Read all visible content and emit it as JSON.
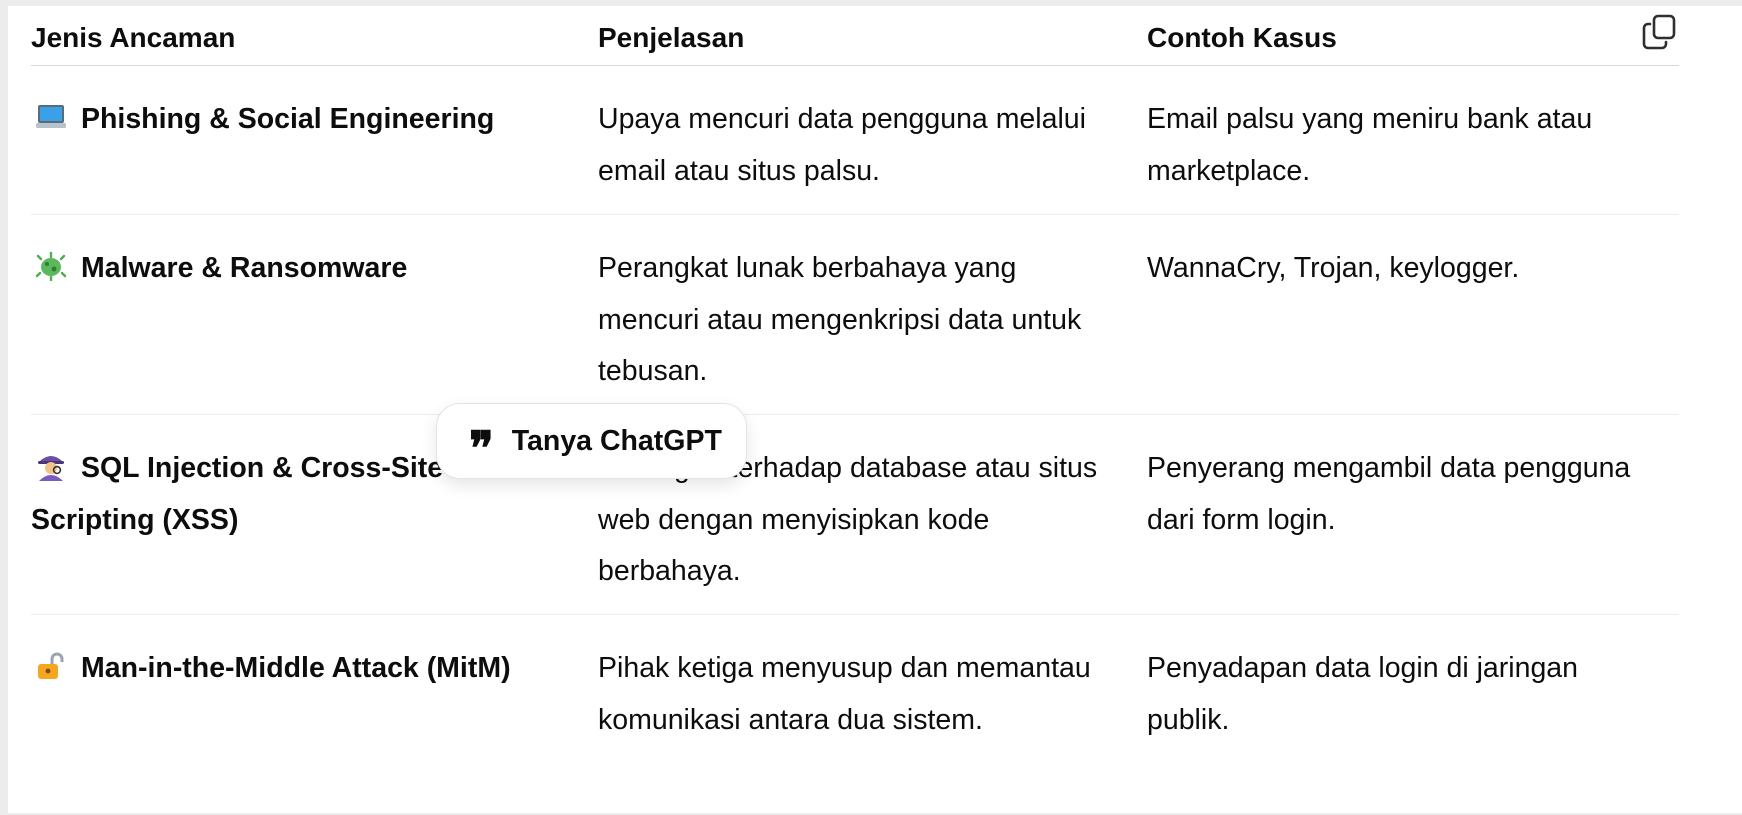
{
  "table": {
    "headers": [
      "Jenis Ancaman",
      "Penjelasan",
      "Contoh Kasus"
    ],
    "rows": [
      {
        "icon": "laptop-icon",
        "threat": "Phishing & Social Engineering",
        "explanation": "Upaya mencuri data pengguna melalui email atau situs palsu.",
        "example": "Email palsu yang meniru bank atau marketplace."
      },
      {
        "icon": "microbe-icon",
        "threat": "Malware & Ransomware",
        "explanation": "Perangkat lunak berbahaya yang mencuri atau mengenkripsi data untuk tebusan.",
        "example": "WannaCry, Trojan, keylogger."
      },
      {
        "icon": "spy-icon",
        "threat": "SQL Injection & Cross-Site Scripting (XSS)",
        "explanation": "Serangan terhadap database atau situs web dengan menyisipkan kode berbahaya.",
        "example": "Penyerang mengambil data pengguna dari form login."
      },
      {
        "icon": "unlocked-padlock-icon",
        "threat": "Man-in-the-Middle Attack (MitM)",
        "explanation": "Pihak ketiga menyusup dan memantau komunikasi antara dua sistem.",
        "example": "Penyadapan data login di jaringan publik."
      }
    ]
  },
  "popup": {
    "label": "Tanya ChatGPT",
    "icon": "quote-icon"
  },
  "toolbar": {
    "copy_icon": "copy-icon"
  },
  "colors": {
    "text": "#0d0d0d",
    "divider": "#ececec",
    "background": "#ffffff"
  }
}
